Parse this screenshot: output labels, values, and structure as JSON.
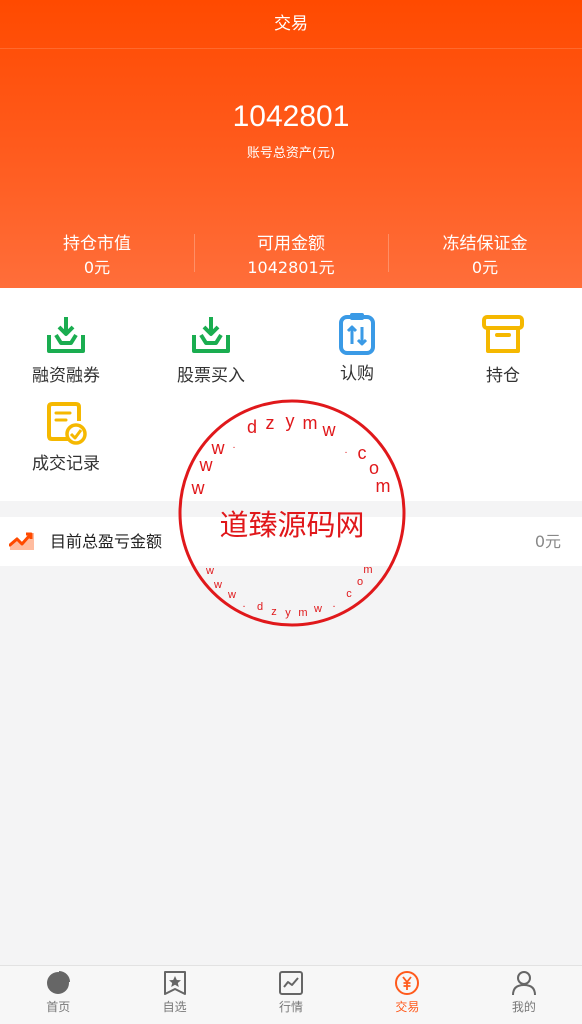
{
  "header": {
    "title": "交易",
    "total_assets": "1042801",
    "total_assets_label": "账号总资产(元)",
    "stats": [
      {
        "label": "持仓市值",
        "value": "0元"
      },
      {
        "label": "可用金额",
        "value": "1042801元"
      },
      {
        "label": "冻结保证金",
        "value": "0元"
      }
    ]
  },
  "menu": {
    "items": [
      {
        "label": "融资融券",
        "icon": "download-tray-icon",
        "color": "#1aad50"
      },
      {
        "label": "股票买入",
        "icon": "download-tray-icon",
        "color": "#1aad50"
      },
      {
        "label": "认购",
        "icon": "clipboard-exchange-icon",
        "color": "#3a9ae6"
      },
      {
        "label": "持仓",
        "icon": "archive-box-icon",
        "color": "#f5b800"
      },
      {
        "label": "成交记录",
        "icon": "document-check-icon",
        "color": "#f5b800"
      }
    ]
  },
  "profit": {
    "label": "目前总盈亏金额",
    "value": "0元",
    "icon": "trend-chart-icon"
  },
  "watermark": {
    "title": "道臻源码网",
    "top_text": "www.dzymw.com",
    "bottom_text": "www.dzymw.com",
    "color": "#e0181b"
  },
  "tabbar": {
    "items": [
      {
        "label": "首页",
        "icon": "pie-chart-icon"
      },
      {
        "label": "自选",
        "icon": "star-bookmark-icon"
      },
      {
        "label": "行情",
        "icon": "line-chart-icon"
      },
      {
        "label": "交易",
        "icon": "yen-circle-icon",
        "active": true
      },
      {
        "label": "我的",
        "icon": "user-icon"
      }
    ]
  },
  "colors": {
    "accent": "#ff5a1c",
    "green": "#1aad50",
    "blue": "#3a9ae6",
    "yellow": "#f5b800"
  }
}
